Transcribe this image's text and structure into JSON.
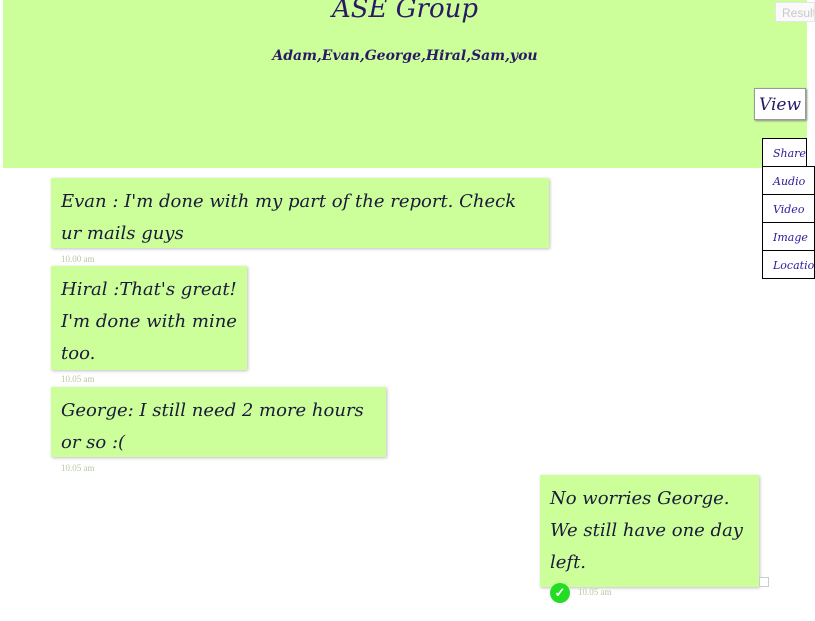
{
  "header": {
    "title": "ASE Group",
    "members": "Adam,Evan,George,Hiral,Sam,you"
  },
  "result_box": {
    "placeholder": "Result"
  },
  "view_button": {
    "label": "View"
  },
  "share_menu": {
    "label": "Share",
    "items": [
      "Audio",
      "Video",
      "Image",
      "Location"
    ]
  },
  "messages": [
    {
      "text": "Evan : I'm done with my part of the report. Check ur mails guys",
      "time": "10.00 am"
    },
    {
      "text": "Hiral :That's great!\nI'm done with mine too.",
      "time": "10.05 am"
    },
    {
      "text": "George: I still need 2 more hours or so :(",
      "time": "10.05 am"
    },
    {
      "text": "No worries George.\nWe still have one day left.",
      "time": "10.05 am",
      "status_icon": "check-circle-icon",
      "status_color": "#22dd22"
    }
  ],
  "colors": {
    "bubble": "#ccff99",
    "header": "#ccff99",
    "title_text": "#2a1a66"
  }
}
